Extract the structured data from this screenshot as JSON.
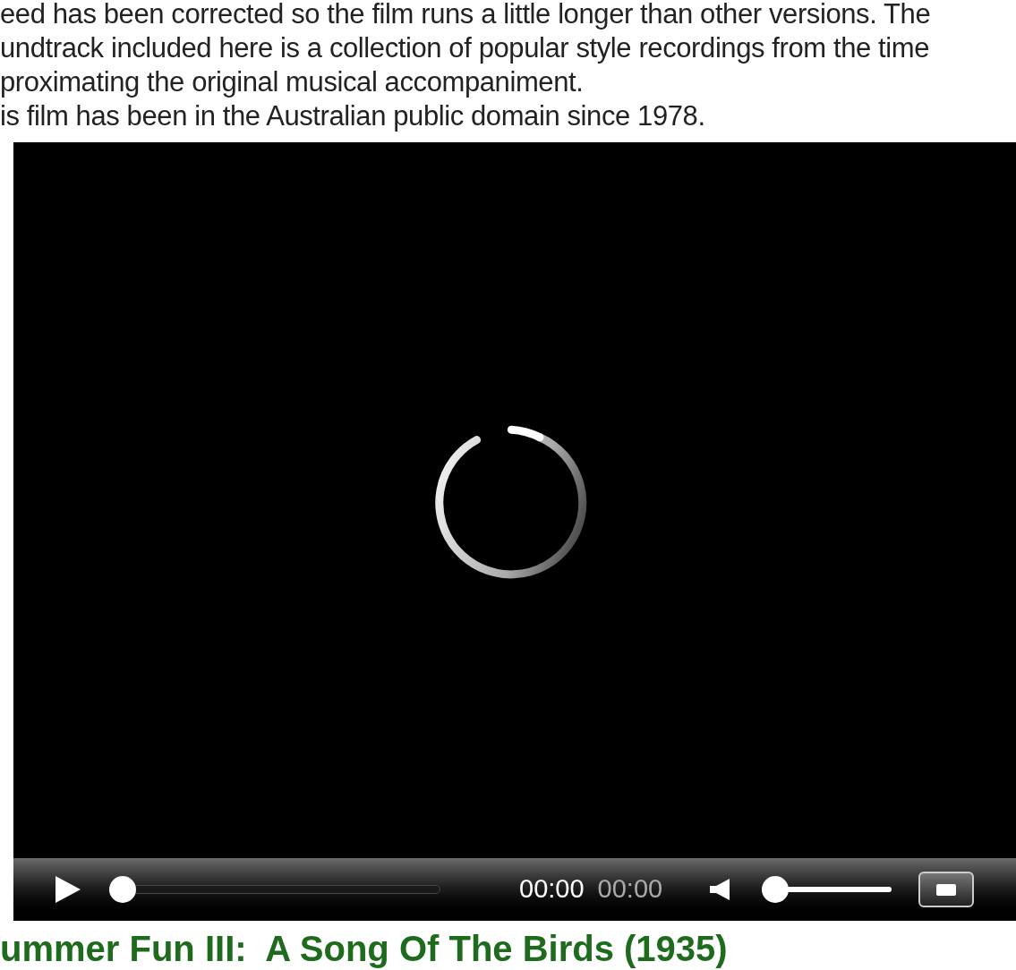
{
  "description": {
    "lines": [
      "eed has been corrected so the film runs a little longer than other versions. The",
      "undtrack included here is a collection of popular style recordings from the time",
      "proximating the original musical accompaniment."
    ]
  },
  "note": "is film has been in the Australian public domain since 1978.",
  "player": {
    "loading": true,
    "seek": {
      "level": 0
    },
    "current_time": "00:00",
    "duration": "00:00",
    "volume": {
      "level": 0
    }
  },
  "title": "ummer Fun III:  A Song Of The Birds (1935)"
}
